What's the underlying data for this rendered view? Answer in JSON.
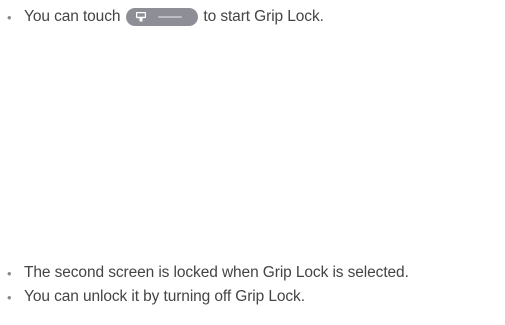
{
  "bullets_top": [
    {
      "before": "You can touch",
      "after": "to start Grip Lock.",
      "button_icon": "grip-lock-icon",
      "button_color": "#8e8e96"
    }
  ],
  "bullets_bottom": [
    "The second screen is locked when Grip Lock is selected.",
    "You can unlock it by turning off Grip Lock."
  ],
  "bullet_glyph": "•"
}
